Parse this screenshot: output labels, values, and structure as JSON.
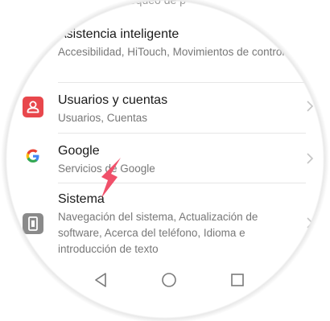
{
  "top_partial_text": "bloqueo de p",
  "items": [
    {
      "title": "Asistencia inteligente",
      "subtitle": "Accesibilidad, HiTouch, Movimientos de control"
    },
    {
      "title": "Usuarios y cuentas",
      "subtitle": "Usuarios, Cuentas",
      "icon": "user-account-icon",
      "icon_color": "#e8474c"
    },
    {
      "title": "Google",
      "subtitle": "Servicios de Google",
      "icon": "google-g-icon"
    },
    {
      "title": "Sistema",
      "subtitle": "Navegación del sistema, Actualización de software, Acerca del teléfono, Idioma e introducción de texto",
      "icon": "phone-system-icon",
      "icon_color": "#8a8a8a"
    }
  ],
  "annotation_arrow_color": "#f0506a",
  "navbar": {
    "back_icon": "back-triangle-icon",
    "home_icon": "home-circle-icon",
    "recents_icon": "recents-square-icon"
  }
}
